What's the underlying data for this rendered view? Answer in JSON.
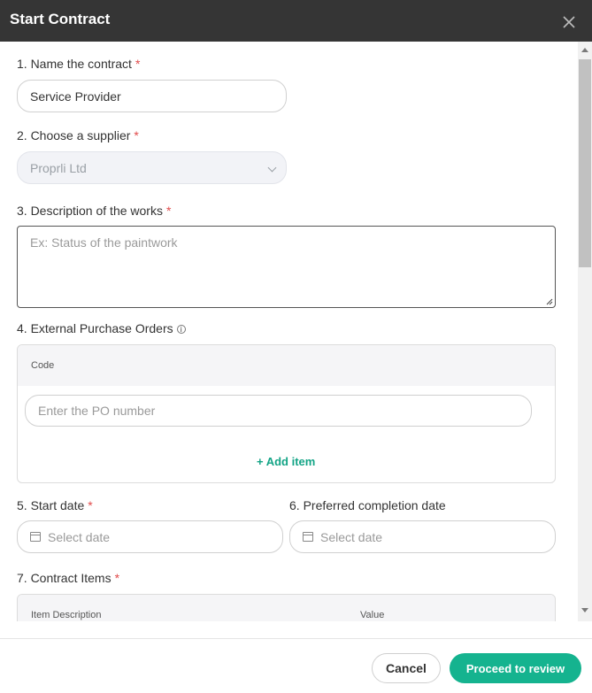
{
  "header": {
    "title": "Start Contract",
    "close_icon": "close-icon"
  },
  "form": {
    "name": {
      "label": "1. Name the contract",
      "required": "*",
      "value": "Service Provider"
    },
    "supplier": {
      "label": "2. Choose a supplier",
      "required": "*",
      "value": "Proprli Ltd"
    },
    "description": {
      "label": "3. Description of the works",
      "required": "*",
      "placeholder": "Ex: Status of the paintwork"
    },
    "purchase_orders": {
      "label": "4. External Purchase Orders",
      "info_icon": "info-icon",
      "column_code": "Code",
      "po_placeholder": "Enter the PO number",
      "add_item": "+ Add item"
    },
    "start_date": {
      "label": "5. Start date",
      "required": "*",
      "placeholder": "Select date"
    },
    "completion_date": {
      "label": "6. Preferred completion date",
      "placeholder": "Select date"
    },
    "contract_items": {
      "label": "7. Contract Items",
      "required": "*",
      "columns": [
        "Item Description",
        "Value"
      ]
    }
  },
  "footer": {
    "cancel": "Cancel",
    "proceed": "Proceed to review"
  },
  "colors": {
    "header_bg": "#353535",
    "accent": "#15b38f",
    "required": "#e14b4b"
  }
}
